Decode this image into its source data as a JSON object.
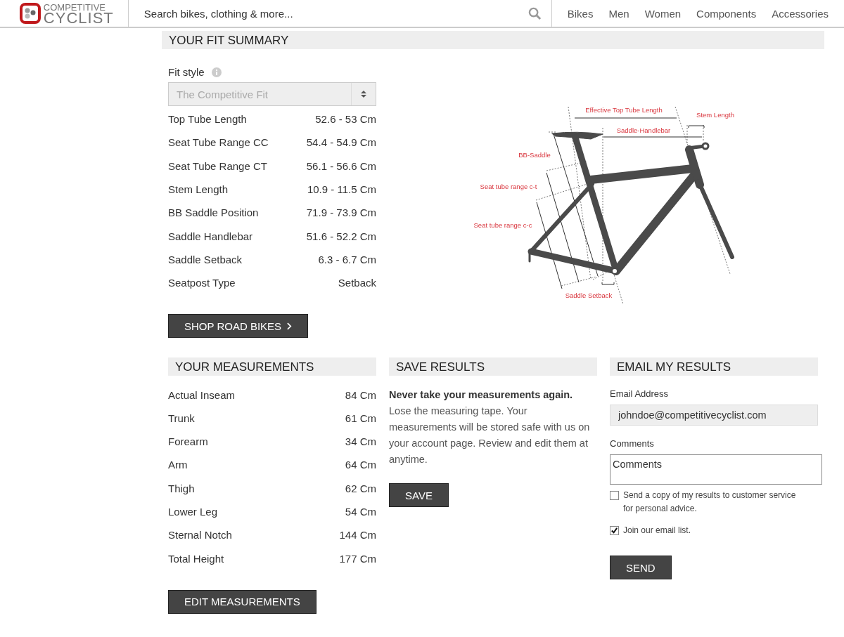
{
  "header": {
    "logo_top": "COMPETITIVE",
    "logo_bottom": "CYCLIST",
    "search": {
      "placeholder": "Search bikes, clothing & more..."
    },
    "nav": [
      "Bikes",
      "Men",
      "Women",
      "Components",
      "Accessories"
    ]
  },
  "fit_summary": {
    "title": "YOUR FIT SUMMARY",
    "fit_style_label": "Fit style",
    "fit_style_value": "The Competitive Fit",
    "rows": [
      {
        "label": "Top Tube Length",
        "value": "52.6 - 53 Cm"
      },
      {
        "label": "Seat Tube Range CC",
        "value": "54.4 - 54.9 Cm"
      },
      {
        "label": "Seat Tube Range CT",
        "value": "56.1 - 56.6 Cm"
      },
      {
        "label": "Stem Length",
        "value": "10.9 - 11.5 Cm"
      },
      {
        "label": "BB Saddle Position",
        "value": "71.9 - 73.9 Cm"
      },
      {
        "label": "Saddle Handlebar",
        "value": "51.6 - 52.2 Cm"
      },
      {
        "label": "Saddle Setback",
        "value": "6.3 - 6.7 Cm"
      },
      {
        "label": "Seatpost Type",
        "value": "Setback"
      }
    ],
    "button": "SHOP ROAD BIKES",
    "diagram_labels": [
      "Effective Top Tube Length",
      "Stem Length",
      "Saddle-Handlebar",
      "BB-Saddle",
      "Seat tube range c-t",
      "Seat tube range c-c",
      "Saddle Setback"
    ]
  },
  "measurements": {
    "title": "YOUR MEASUREMENTS",
    "rows": [
      {
        "label": "Actual Inseam",
        "value": "84 Cm"
      },
      {
        "label": "Trunk",
        "value": "61 Cm"
      },
      {
        "label": "Forearm",
        "value": "34 Cm"
      },
      {
        "label": "Arm",
        "value": "64 Cm"
      },
      {
        "label": "Thigh",
        "value": "62 Cm"
      },
      {
        "label": "Lower Leg",
        "value": "54 Cm"
      },
      {
        "label": "Sternal Notch",
        "value": "144 Cm"
      },
      {
        "label": "Total Height",
        "value": "177 Cm"
      }
    ],
    "button": "EDIT MEASUREMENTS"
  },
  "save_results": {
    "title": "SAVE RESULTS",
    "text": "**Never take your measurements again.** Lose the measuring tape. Your measurements will be stored safe with us on your account page. Review and edit them at anytime.",
    "button": "SAVE"
  },
  "email_results": {
    "title": "EMAIL MY RESULTS",
    "email_label": "Email Address",
    "email_value": "johndoe@competitivecyclist.com",
    "comments_label": "Comments",
    "comments_placeholder": "Comments",
    "checkboxes": [
      {
        "label": "Send a copy of my results to customer service for personal advice.",
        "checked": false
      },
      {
        "label": "Join our email list.",
        "checked": true
      }
    ],
    "button": "SEND"
  }
}
